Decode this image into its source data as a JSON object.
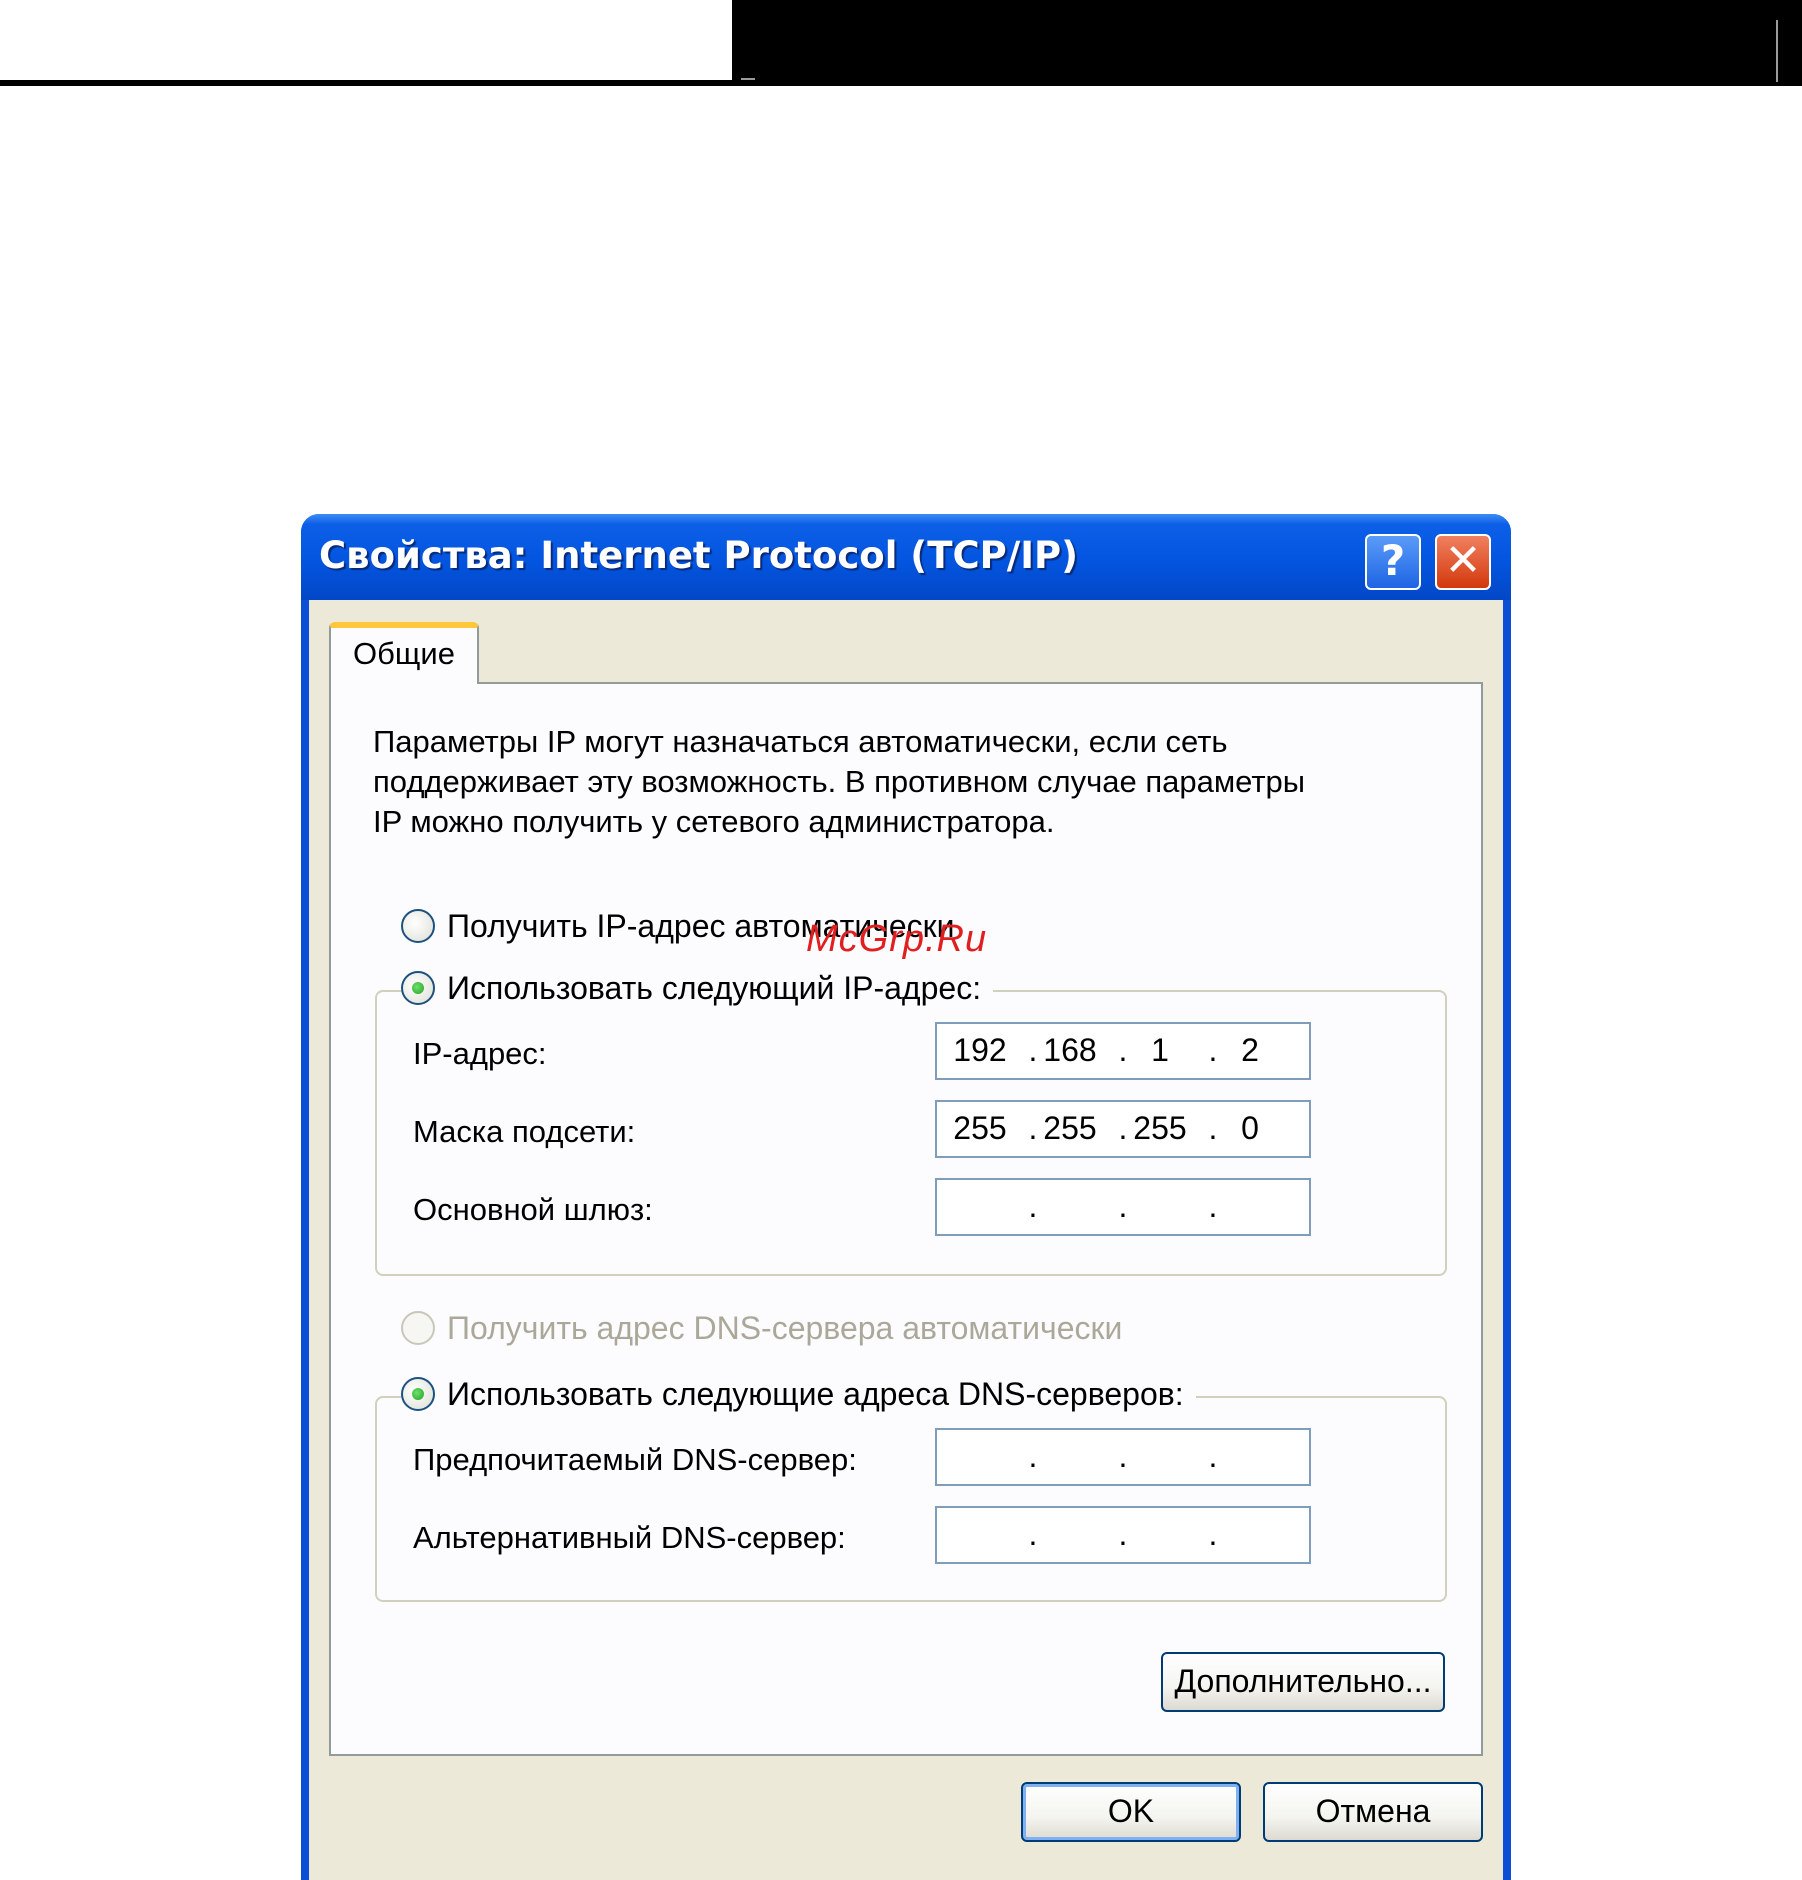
{
  "dialog": {
    "title": "Свойства: Internet Protocol (TCP/IP)",
    "help_glyph": "?",
    "close_glyph": "✕"
  },
  "tab": {
    "label": "Общие"
  },
  "description": [
    "Параметры IP могут назначаться автоматически, если сеть",
    "поддерживает эту возможность. В противном случае параметры",
    "IP можно получить у сетевого администратора."
  ],
  "ip_mode": {
    "auto_label": "Получить IP-адрес автоматически",
    "auto_selected": false,
    "manual_label": "Использовать следующий IP-адрес:",
    "manual_selected": true
  },
  "ip_fields": {
    "ip_address": {
      "label": "IP-адрес:",
      "octets": [
        "192",
        "168",
        "1",
        "2"
      ]
    },
    "subnet_mask": {
      "label": "Маска подсети:",
      "octets": [
        "255",
        "255",
        "255",
        "0"
      ]
    },
    "gateway": {
      "label": "Основной шлюз:",
      "octets": [
        "",
        "",
        "",
        ""
      ]
    }
  },
  "dns_mode": {
    "auto_label": "Получить адрес DNS-сервера автоматически",
    "auto_enabled": false,
    "manual_label": "Использовать следующие адреса DNS-серверов:",
    "manual_selected": true
  },
  "dns_fields": {
    "preferred": {
      "label": "Предпочитаемый DNS-сервер:",
      "octets": [
        "",
        "",
        "",
        ""
      ]
    },
    "alternate": {
      "label": "Альтернативный DNS-сервер:",
      "octets": [
        "",
        "",
        "",
        ""
      ]
    }
  },
  "buttons": {
    "advanced": "Дополнительно...",
    "ok": "OK",
    "cancel": "Отмена"
  },
  "ip_separator": ".",
  "watermark": "McGrp.Ru",
  "colors": {
    "titlebar": "#0355e0",
    "close_button": "#d4380c",
    "dialog_face": "#ece9d8",
    "tab_highlight": "#ffc83c",
    "radio_dot": "#21a121"
  }
}
